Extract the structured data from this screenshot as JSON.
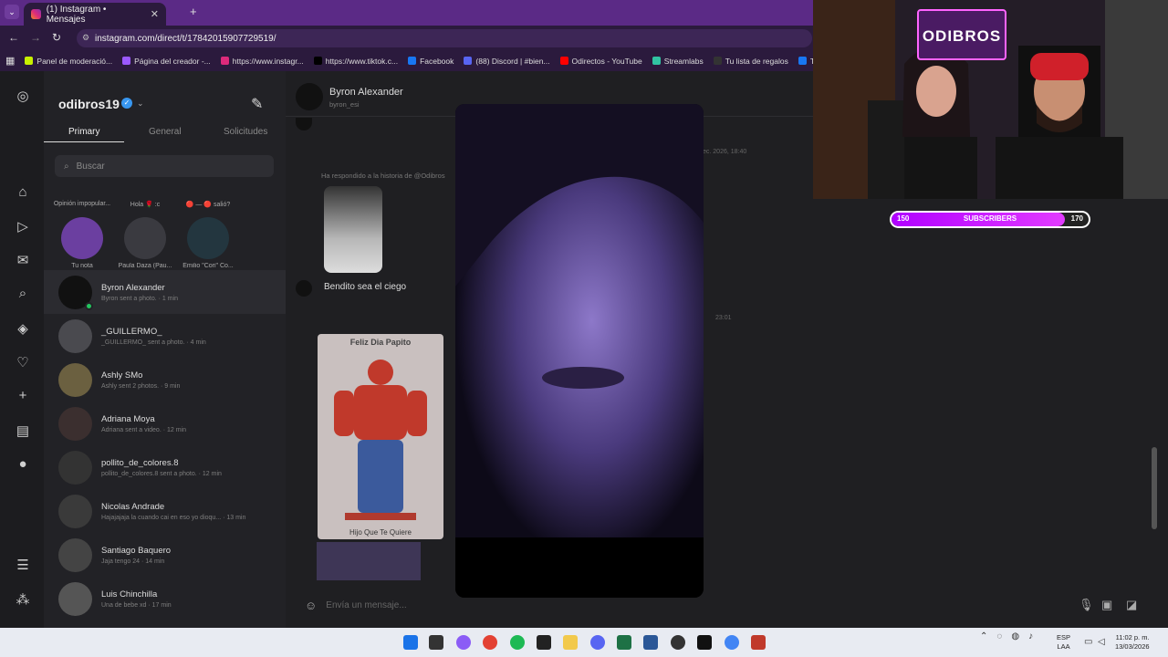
{
  "browser": {
    "tab_title": "(1) Instagram • Mensajes",
    "tab_close": "✕",
    "new_tab": "+",
    "url": "instagram.com/direct/t/17842015907729519/",
    "bookmarks": [
      {
        "label": "Panel de moderació...",
        "color": "#c8f000"
      },
      {
        "label": "Página del creador -...",
        "color": "#9b59ff"
      },
      {
        "label": "https://www.instagr...",
        "color": "#dd2a7b"
      },
      {
        "label": "https://www.tiktok.c...",
        "color": "#000000"
      },
      {
        "label": "Facebook",
        "color": "#1877f2"
      },
      {
        "label": "(88) Discord | #bien...",
        "color": "#5865f2"
      },
      {
        "label": "Odirectos - YouTube",
        "color": "#ff0000"
      },
      {
        "label": "Streamlabs",
        "color": "#31c3a2"
      },
      {
        "label": "Tu lista de regalos",
        "color": "#333333"
      },
      {
        "label": "Te c",
        "color": "#1877f2"
      }
    ]
  },
  "instagram": {
    "username": "odibros19",
    "verified_mark": "✓",
    "tabs": {
      "primary": "Primary",
      "general": "General",
      "requests": "Solicitudes"
    },
    "search_placeholder": "Buscar",
    "notes": [
      {
        "bubble": "Opinión impopular...",
        "name": "Tu nota",
        "color": "#6b3fa0"
      },
      {
        "bubble": "Hola 🌹 :c",
        "name": "Paula Daza (Pau...",
        "color": "#3a3a40"
      },
      {
        "bubble": "🔴 — 🔴 salió?",
        "name": "Emilio \"Cori\" Co...",
        "color": "#23363f"
      }
    ],
    "conversations": [
      {
        "name": "Byron Alexander",
        "preview": "Byron sent a photo. · 1 min"
      },
      {
        "name": "_GUILLERMO_",
        "preview": "_GUILLERMO_ sent a photo. · 4 min"
      },
      {
        "name": "Ashly SMo",
        "preview": "Ashly sent 2 photos. · 9 min"
      },
      {
        "name": "Adriana Moya",
        "preview": "Adriana sent a video. · 12 min"
      },
      {
        "name": "pollito_de_colores.8",
        "preview": "pollito_de_colores.8 sent a photo. · 12 min"
      },
      {
        "name": "Nicolas Andrade",
        "preview": "Hajajajaja la cuando cai en eso yo dioqu... · 13 min"
      },
      {
        "name": "Santiago Baquero",
        "preview": "Jaja tengo 24 · 14 min"
      },
      {
        "name": "Luis Chinchilla",
        "preview": "Una de bebe xd · 17 min"
      }
    ],
    "chat": {
      "name": "Byron Alexander",
      "handle": "byron_esi",
      "reply_note": "Ha respondido a la historia de @Odibros",
      "message": "Bendito sea el ciego",
      "ts1": "ec. 2026, 18:40",
      "ts2": "23:01",
      "photo_caption": "Feliz Dia Papito",
      "photo_caption2": "Hijo Que Te Quiere",
      "composer_placeholder": "Envía un mensaje..."
    }
  },
  "stream": {
    "neon_sign": "ODIBROS",
    "subs_current": "150",
    "subs_label": "SUBSCRIBERS",
    "subs_goal": "170",
    "subs_progress": 0.88
  },
  "taskbar": {
    "lang_line1": "ESP",
    "lang_line2": "LAA",
    "time": "11:02 p. m.",
    "date": "13/03/2026"
  }
}
